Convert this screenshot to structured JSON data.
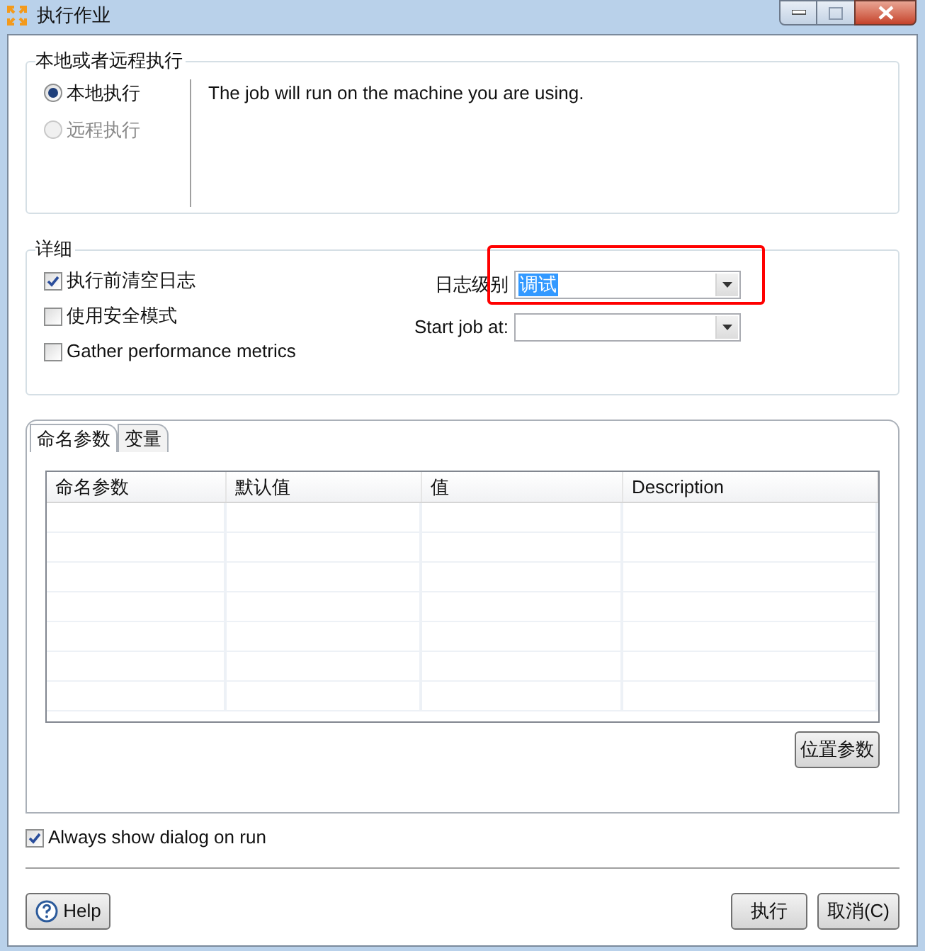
{
  "window": {
    "title": "执行作业"
  },
  "location_group": {
    "title": "本地或者远程执行",
    "options": [
      {
        "label": "本地执行",
        "selected": true,
        "disabled": false
      },
      {
        "label": "远程执行",
        "selected": false,
        "disabled": true
      }
    ],
    "description": "The job will run on the machine you are using."
  },
  "details_group": {
    "title": "详细",
    "checkboxes": [
      {
        "label": "执行前清空日志",
        "checked": true
      },
      {
        "label": "使用安全模式",
        "checked": false
      },
      {
        "label": "Gather performance metrics",
        "checked": false
      }
    ],
    "log_level": {
      "label": "日志级别",
      "value": "调试",
      "highlighted": true
    },
    "start_job": {
      "label": "Start job at:"
    }
  },
  "tabs": [
    {
      "label": "命名参数",
      "selected": true
    },
    {
      "label": "变量",
      "selected": false
    }
  ],
  "table": {
    "columns": [
      "命名参数",
      "默认值",
      "值",
      "Description"
    ]
  },
  "positional_button": "位置参数",
  "always_show": {
    "label": "Always show dialog on run",
    "checked": true
  },
  "buttons": {
    "help": "Help",
    "run": "执行",
    "cancel": "取消(C)"
  }
}
